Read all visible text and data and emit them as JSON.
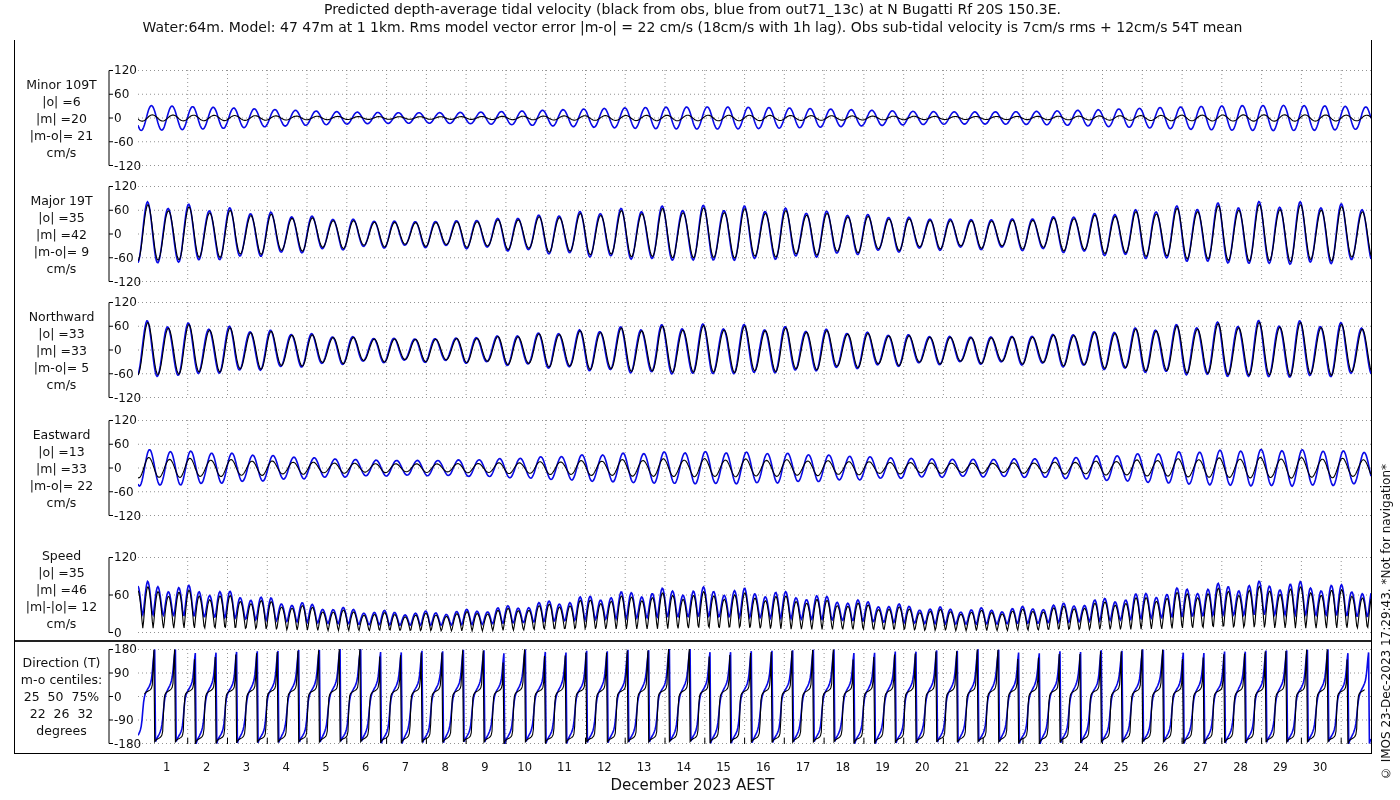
{
  "title": {
    "line_1": "Predicted depth-average tidal velocity (black from obs, blue from out71_13c) at N Bugatti Rf 20S 150.3E.",
    "line_2": "Water:64m. Model: 47 47m at 1 1km. Rms model vector error |m-o| = 22 cm/s (18cm/s with 1h lag). Obs sub-tidal velocity is 7cm/s rms + 12cm/s 54T mean"
  },
  "panels": [
    {
      "kind": "minor",
      "label_lines": [
        "Minor 109T",
        "|o| =6",
        "|m| =20",
        "|m-o|= 21",
        "cm/s"
      ],
      "yticks": [
        "120",
        "60",
        "0",
        "-60",
        "-120"
      ]
    },
    {
      "kind": "major",
      "label_lines": [
        "Major 19T",
        "|o| =35",
        "|m| =42",
        "|m-o|= 9",
        "cm/s"
      ],
      "yticks": [
        "120",
        "60",
        "0",
        "-60",
        "-120"
      ]
    },
    {
      "kind": "north",
      "label_lines": [
        "Northward",
        "|o| =33",
        "|m| =33",
        "|m-o|= 5",
        "cm/s"
      ],
      "yticks": [
        "120",
        "60",
        "0",
        "-60",
        "-120"
      ]
    },
    {
      "kind": "east",
      "label_lines": [
        "Eastward",
        "|o| =13",
        "|m| =33",
        "|m-o|= 22",
        "cm/s"
      ],
      "yticks": [
        "120",
        "60",
        "0",
        "-60",
        "-120"
      ]
    },
    {
      "kind": "speed",
      "label_lines": [
        "Speed",
        "|o| =35",
        "|m| =46",
        "|m|-|o|= 12",
        "cm/s"
      ],
      "yticks": [
        "120",
        "60",
        "0"
      ]
    }
  ],
  "direction_panel": {
    "kind": "direction",
    "label_lines": [
      "Direction (T)",
      "m-o centiles:",
      "25  50  75%",
      "22  26  32",
      "degrees"
    ],
    "yticks": [
      "180",
      "90",
      "0",
      "-90",
      "-180"
    ]
  },
  "x_axis": {
    "day_labels": [
      "1",
      "2",
      "3",
      "4",
      "5",
      "6",
      "7",
      "8",
      "9",
      "10",
      "11",
      "12",
      "13",
      "14",
      "15",
      "16",
      "17",
      "18",
      "19",
      "20",
      "21",
      "22",
      "23",
      "24",
      "25",
      "26",
      "27",
      "28",
      "29",
      "30"
    ],
    "xlabel": "December 2023 AEST"
  },
  "credit": "© IMOS 23-Dec-2023 17:29:43. *Not for navigation*"
}
